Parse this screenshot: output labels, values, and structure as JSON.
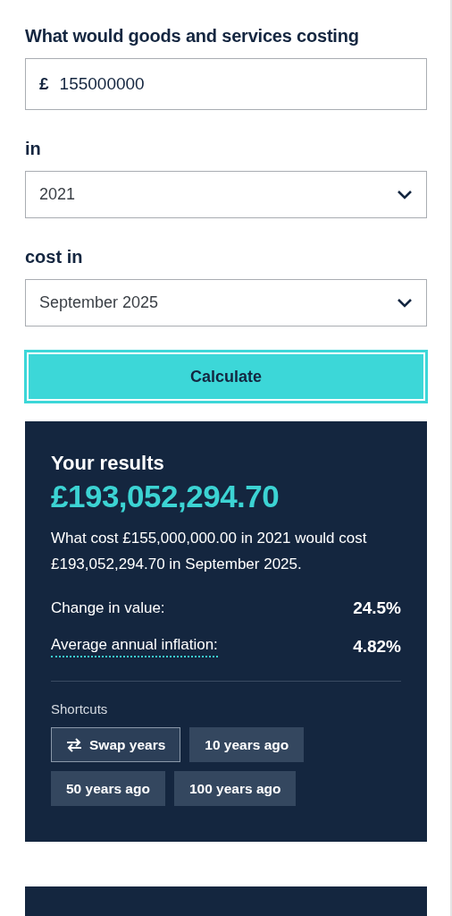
{
  "amount": {
    "label": "What would goods and services costing",
    "currency": "£",
    "value": "155000000"
  },
  "from": {
    "label": "in",
    "value": "2021"
  },
  "to": {
    "label": "cost in",
    "value": "September 2025"
  },
  "calculate_button": "Calculate",
  "results": {
    "title": "Your results",
    "amount": "£193,052,294.70",
    "summary": "What cost £155,000,000.00 in 2021 would cost £193,052,294.70 in September 2025.",
    "stats": [
      {
        "label": "Change in value:",
        "value": "24.5%",
        "kind": "plain"
      },
      {
        "label": "Average annual inflation:",
        "value": "4.82%",
        "kind": "term"
      }
    ],
    "shortcuts_label": "Shortcuts",
    "shortcuts": [
      {
        "label": "Swap years",
        "kind": "swap"
      },
      {
        "label": "10 years ago",
        "kind": "preset"
      },
      {
        "label": "50 years ago",
        "kind": "preset"
      },
      {
        "label": "100 years ago",
        "kind": "preset"
      }
    ]
  }
}
